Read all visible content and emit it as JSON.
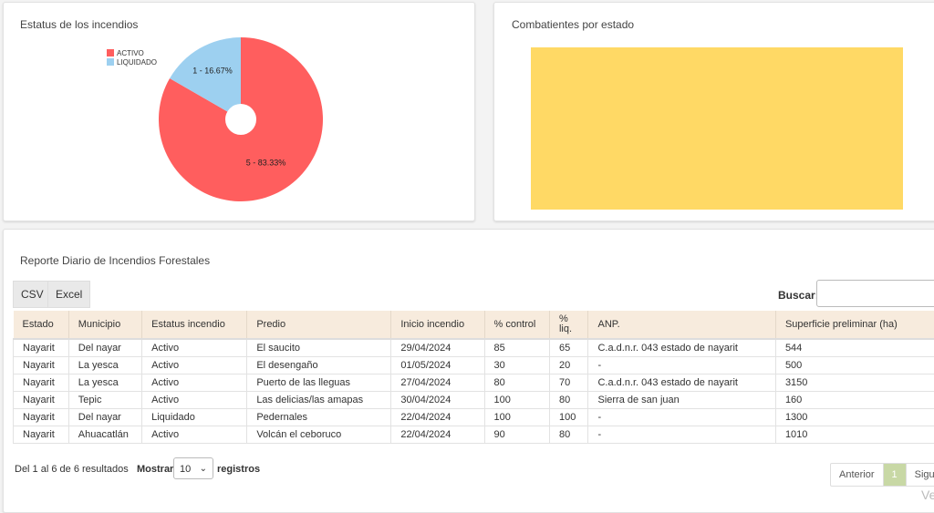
{
  "pie_card": {
    "title": "Estatus de los incendios",
    "legend": [
      {
        "label": "ACTIVO",
        "color": "#ff5e5e"
      },
      {
        "label": "LIQUIDADO",
        "color": "#9dd0f0"
      }
    ]
  },
  "chart_data": [
    {
      "type": "pie",
      "title": "Estatus de los incendios",
      "categories": [
        "ACTIVO",
        "LIQUIDADO"
      ],
      "values": [
        5,
        1
      ],
      "percent": [
        83.33,
        16.67
      ],
      "labels": [
        "5 - 83.33%",
        "1 - 16.67%"
      ],
      "colors": [
        "#ff5e5e",
        "#9dd0f0"
      ],
      "legend": "top-left"
    },
    {
      "type": "bar",
      "title": "Combatientes por estado",
      "color": "#ffd965"
    }
  ],
  "bar_card": {
    "title": "Combatientes por estado"
  },
  "table_card": {
    "title": "Reporte Diario de Incendios Forestales",
    "buttons": {
      "csv": "CSV",
      "excel": "Excel"
    },
    "search_label": "Buscar:",
    "search_value": "",
    "columns": [
      "Estado",
      "Municipio",
      "Estatus incendio",
      "Predio",
      "Inicio incendio",
      "% control",
      "%\nliq.",
      "ANP.",
      "Superficie preliminar (ha)"
    ],
    "rows": [
      [
        "Nayarit",
        "Del nayar",
        "Activo",
        "El saucito",
        "29/04/2024",
        "85",
        "65",
        "C.a.d.n.r. 043 estado de nayarit",
        "544"
      ],
      [
        "Nayarit",
        "La yesca",
        "Activo",
        "El desengaño",
        "01/05/2024",
        "30",
        "20",
        "-",
        "500"
      ],
      [
        "Nayarit",
        "La yesca",
        "Activo",
        "Puerto de las lleguas",
        "27/04/2024",
        "80",
        "70",
        "C.a.d.n.r. 043 estado de nayarit",
        "3150"
      ],
      [
        "Nayarit",
        "Tepic",
        "Activo",
        "Las delicias/las amapas",
        "30/04/2024",
        "100",
        "80",
        "Sierra de san juan",
        "160"
      ],
      [
        "Nayarit",
        "Del nayar",
        "Liquidado",
        "Pedernales",
        "22/04/2024",
        "100",
        "100",
        "-",
        "1300"
      ],
      [
        "Nayarit",
        "Ahuacatlán",
        "Activo",
        "Volcán el ceboruco",
        "22/04/2024",
        "90",
        "80",
        "-",
        "1010"
      ]
    ],
    "summary": "Del 1 al 6 de 6 resultados",
    "show_label": "Mostrar",
    "show_value": "10",
    "show_suffix": "registros",
    "pager": {
      "prev": "Anterior",
      "current": "1",
      "next": "Siguiente"
    }
  },
  "watermark": "Ve"
}
